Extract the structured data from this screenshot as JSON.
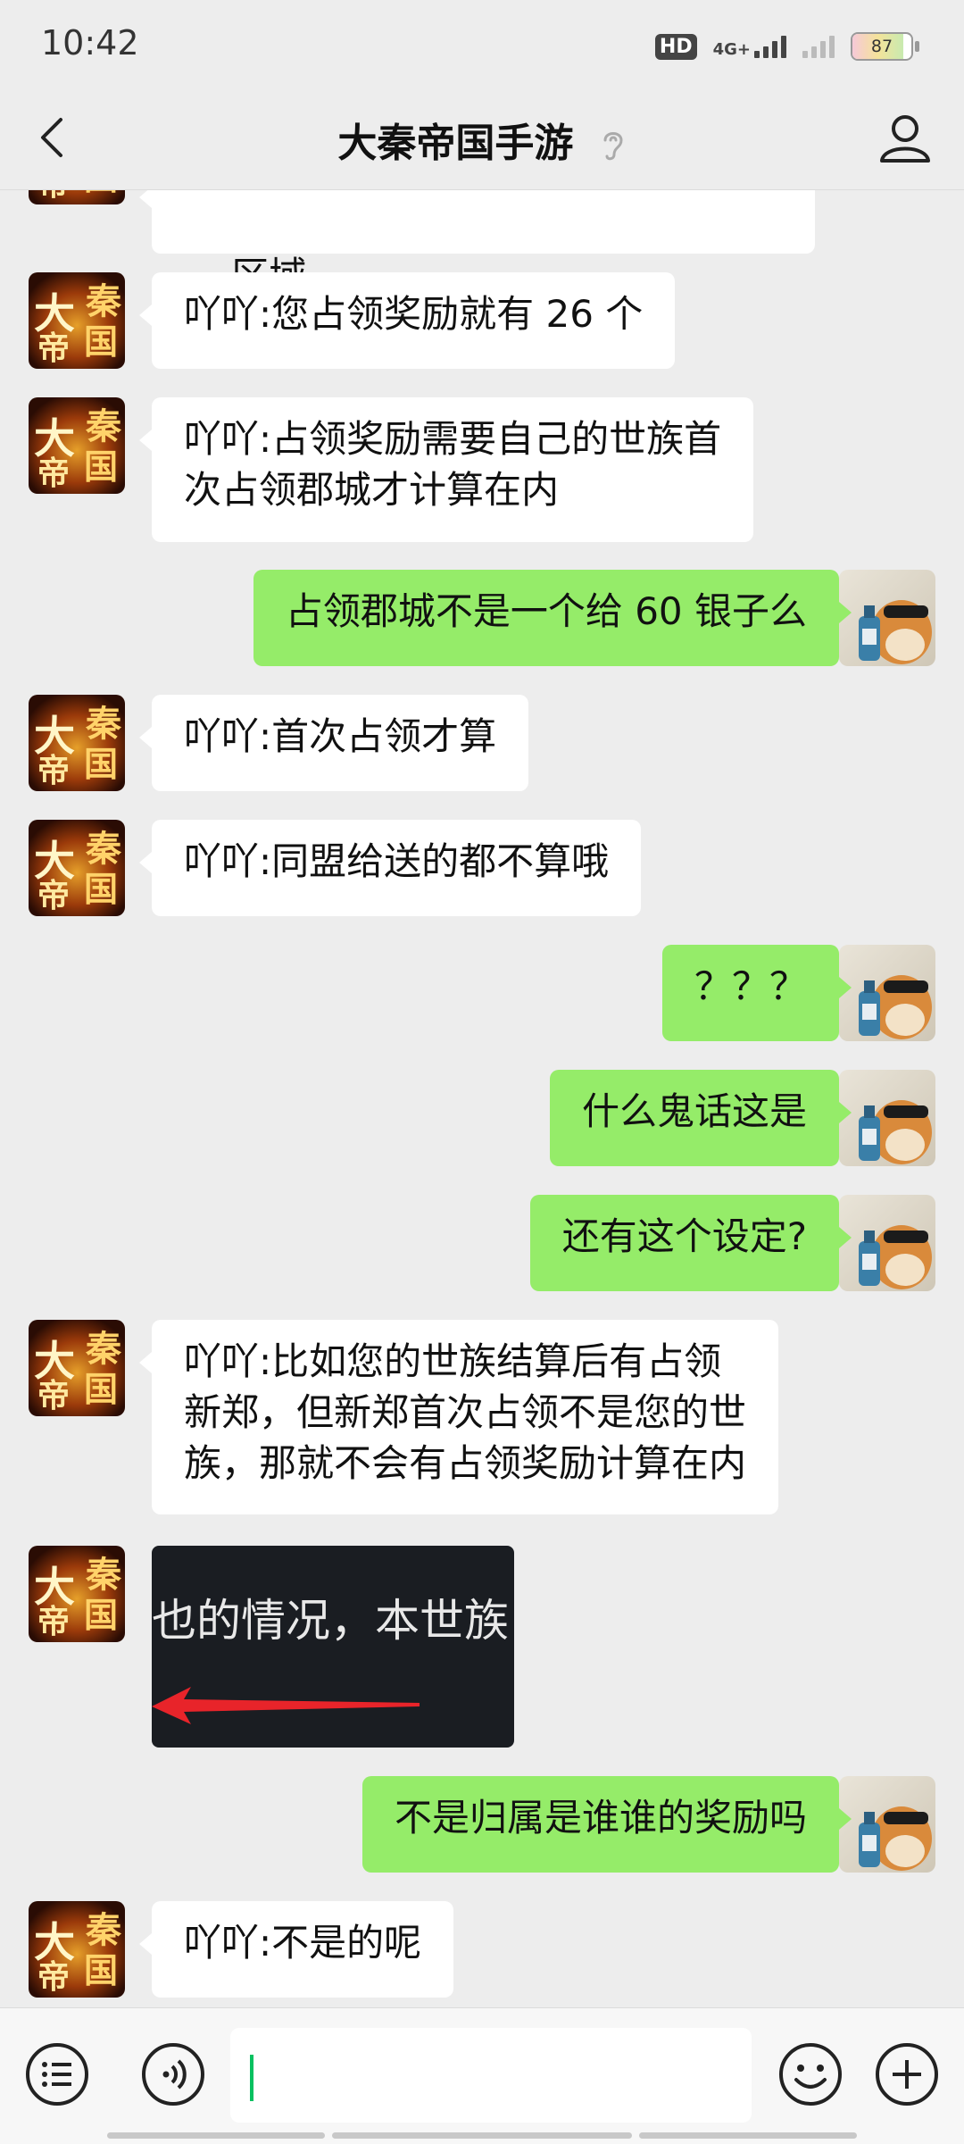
{
  "status_bar": {
    "time": "10:42",
    "hd_label": "HD",
    "network_label": "4G+",
    "battery_level": "87"
  },
  "nav": {
    "title": "大秦帝国手游"
  },
  "messages": [
    {
      "side": "left",
      "text": "区域"
    },
    {
      "side": "left",
      "text": "吖吖:您占领奖励就有 26 个"
    },
    {
      "side": "left",
      "text": "吖吖:占领奖励需要自己的世族首\n次占领郡城才计算在内"
    },
    {
      "side": "right",
      "text": "占领郡城不是一个给 60 银子么"
    },
    {
      "side": "left",
      "text": "吖吖:首次占领才算"
    },
    {
      "side": "left",
      "text": "吖吖:同盟给送的都不算哦"
    },
    {
      "side": "right",
      "text": "？？？"
    },
    {
      "side": "right",
      "text": "什么鬼话这是"
    },
    {
      "side": "right",
      "text": "还有这个设定?"
    },
    {
      "side": "left",
      "text": "吖吖:比如您的世族结算后有占领\n新郑，但新郑首次占领不是您的世\n族，那就不会有占领奖励计算在内"
    },
    {
      "side": "left",
      "type": "image",
      "text": "也的情况，本世族"
    },
    {
      "side": "right",
      "text": "不是归属是谁谁的奖励吗"
    },
    {
      "side": "left",
      "text": "吖吖:不是的呢"
    }
  ],
  "game_avatar_chars": [
    "大",
    "秦",
    "帝",
    "国"
  ],
  "input": {
    "value": ""
  },
  "colors": {
    "background": "#ededed",
    "sent_bubble": "#95ec69",
    "received_bubble": "#ffffff",
    "caret": "#07c160"
  }
}
